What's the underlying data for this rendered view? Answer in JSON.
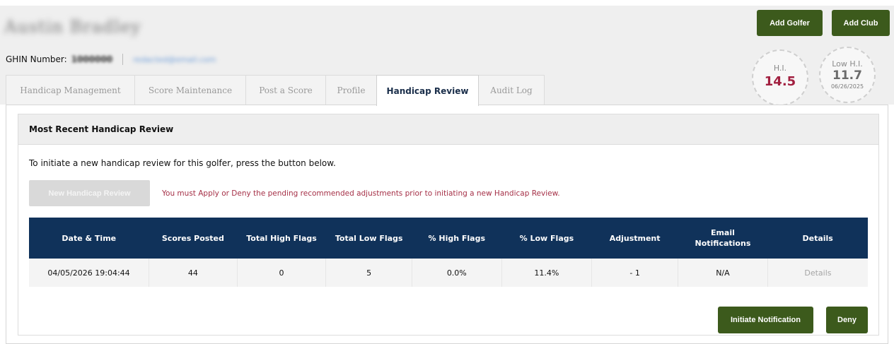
{
  "header": {
    "golfer_name": "Austin Bradley",
    "ghin_label": "GHIN Number:",
    "ghin_value": "1000000",
    "email": "redacted@email.com"
  },
  "actions": {
    "add_golfer": "Add Golfer",
    "add_club": "Add Club"
  },
  "badges": {
    "hi_label": "H.I.",
    "hi_value": "14.5",
    "low_label": "Low H.I.",
    "low_value": "11.7",
    "low_date": "06/26/2025"
  },
  "tabs": [
    {
      "label": "Handicap Management"
    },
    {
      "label": "Score Maintenance"
    },
    {
      "label": "Post a Score"
    },
    {
      "label": "Profile"
    },
    {
      "label": "Handicap Review"
    },
    {
      "label": "Audit Log"
    }
  ],
  "review": {
    "section_title": "Most Recent Handicap Review",
    "intro_text": "To initiate a new handicap review for this golfer, press the button below.",
    "new_review_button": "New Handicap Review",
    "warning": "You must Apply or Deny the pending recommended adjustments prior to initiating a new Handicap Review.",
    "columns": [
      "Date & Time",
      "Scores Posted",
      "Total High Flags",
      "Total Low Flags",
      "% High Flags",
      "% Low Flags",
      "Adjustment",
      "Email Notifications",
      "Details"
    ],
    "rows": [
      {
        "date_time": "04/05/2026 19:04:44",
        "scores_posted": "44",
        "total_high_flags": "0",
        "total_low_flags": "5",
        "pct_high_flags": "0.0%",
        "pct_low_flags": "11.4%",
        "adjustment": "- 1",
        "email_notifications": "N/A",
        "details": "Details"
      }
    ],
    "initiate_button": "Initiate Notification",
    "deny_button": "Deny"
  },
  "colors": {
    "accent_green": "#3c5a1c",
    "header_navy": "#10325a",
    "hi_red": "#a22040",
    "warning_red": "#a53047"
  }
}
